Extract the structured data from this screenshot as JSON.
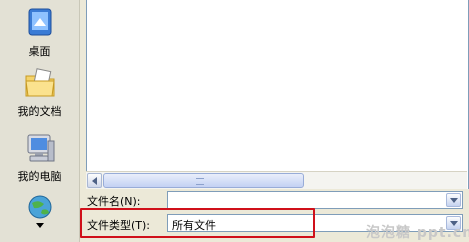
{
  "places": [
    {
      "label": "桌面",
      "icon": "desktop-icon"
    },
    {
      "label": "我的文档",
      "icon": "my-documents-icon"
    },
    {
      "label": "我的电脑",
      "icon": "my-computer-icon"
    },
    {
      "label": "",
      "icon": "network-places-icon"
    }
  ],
  "file_name": {
    "label": "文件名(N):",
    "value": ""
  },
  "file_type": {
    "label": "文件类型(T):",
    "value": "所有文件"
  },
  "watermark": "泡泡糖 ppt.cn",
  "colors": {
    "highlight": "#d0101a",
    "field_border": "#7f9db9"
  }
}
